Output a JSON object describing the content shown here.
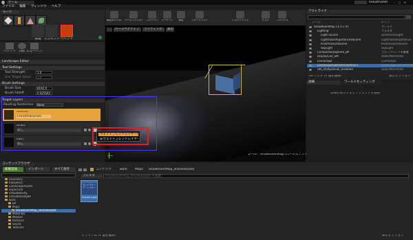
{
  "window": {
    "tab_label": "ゲーム",
    "project_name": "IndustrialVR",
    "search_placeholder": "ドキュメントの検索"
  },
  "menu": [
    "ファイル",
    "編集",
    "ウィンドウ",
    "ヘルプ"
  ],
  "mode_panel": {
    "tab_label": "モード",
    "modes_top": [
      "place-mode",
      "paint-mode",
      "landscape-mode",
      "foliage-mode"
    ],
    "modes_bottom": [
      {
        "label": "管理",
        "icon": "manage-icon"
      },
      {
        "label": "スカルプト",
        "icon": "sculpt-icon"
      },
      {
        "label": "ペイント",
        "icon": "paint-icon"
      }
    ],
    "sub_modes": [
      {
        "label": "ペイント",
        "icon": "paint-brush-icon"
      },
      {
        "label": "円形",
        "icon": "circle-brush-icon"
      },
      {
        "label": "スムージング",
        "icon": "smooth-icon"
      }
    ]
  },
  "landscape_editor": {
    "title": "Landscape Editor",
    "tool_settings": "Tool Settings",
    "tool_strength_label": "Tool Strength",
    "tool_strength_value": "1.0",
    "use_target_value_label": "Use Target Value",
    "use_target_value_value": "1.0",
    "brush_settings": "Brush Settings",
    "brush_size_label": "Brush Size",
    "brush_size_value": "8192.0",
    "brush_falloff_label": "Brush Falloff",
    "brush_falloff_value": "0.425644",
    "target_layers": "Target Layers",
    "painting_restriction_label": "Painting Restriction",
    "painting_restriction_value": "None",
    "layers": [
      {
        "name": "Ground",
        "value": "ChristmasGrass"
      },
      {
        "name": "Grass",
        "value": "なし"
      },
      {
        "name": "Path",
        "value": "なし"
      }
    ]
  },
  "context_menu": {
    "items": [
      "ウェイトブレンドレイヤー(法線)",
      "非ウェイトブレンドレイヤー"
    ]
  },
  "viewport": {
    "perspective_label": "パースペクティブ",
    "lighting_label": "ライティング",
    "show_label": "表示",
    "level_label": "レベル : ShowRoomMap (パーシステント)"
  },
  "toolbar": [
    {
      "label": "現在のレベルを保存",
      "icon": "save-icon"
    },
    {
      "label": "ソースコントロール",
      "icon": "source-control-icon"
    },
    {
      "label": "コンテンツ",
      "icon": "content-icon"
    },
    {
      "label": "マーケット",
      "icon": "market-icon"
    },
    {
      "label": "設定",
      "icon": "settings-icon"
    },
    {
      "label": "ブループリント",
      "icon": "blueprint-icon"
    },
    {
      "label": "シネマティクス",
      "icon": "cinematics-icon"
    },
    {
      "label": "ビルド",
      "icon": "build-icon"
    },
    {
      "label": "コンパイル",
      "icon": "compile-icon"
    }
  ],
  "outliner": {
    "tab_label": "アウトライナ",
    "search_placeholder": "検索",
    "col_label": "ラベル",
    "col_type": "タイプ",
    "rows": [
      {
        "label": "ShowRoomMap (エディタ)",
        "type": "ワールド"
      },
      {
        "label": "Lighting",
        "type": "フォルダ"
      },
      {
        "label": "Light Source",
        "type": "DirectionalLight"
      },
      {
        "label": "LightmassImportanceVolume",
        "type": "LightmassImportance"
      },
      {
        "label": "PostProcessVolume",
        "type": "PostProcessVolume"
      },
      {
        "label": "SkyLight",
        "type": "SkyLight"
      },
      {
        "label": "CompactSkySphere_BP",
        "type": "ブループリントを編集"
      },
      {
        "label": "DisplayCan_SM",
        "type": "StaticMeshActor"
      },
      {
        "label": "Landscape",
        "type": "Landscape"
      },
      {
        "label": "LandscapeGizmoActiveActor1",
        "type": "LandscapeGizmoActive"
      },
      {
        "label": "SM_Utility/Decal_Disabled",
        "type": "StaticMeshActor"
      }
    ],
    "status": "40 アクタ (1 個を選択)",
    "view_options": "表示オプション"
  },
  "details": {
    "tab_label": "詳細",
    "world_settings_tab": "ワールドセッティング",
    "empty_text": "詳細を表示するオブジェクトを選択"
  },
  "content_browser": {
    "tab_label": "コンテンツブラウザ",
    "add_new": "新規追加",
    "import": "インポート",
    "save_all": "すべて保存",
    "breadcrumb": [
      "コンテンツ",
      "work",
      "Maps",
      "ShowRoomMap_sharedassets"
    ],
    "filter_label": "フィルタ",
    "search_placeholder": "ShowRoomMap_sharedassets を検索",
    "folder_search_placeholder": "フォルダを検索",
    "tree": [
      "Geometry",
      "KiteDemo",
      "LandscapeAssets",
      "SuperGrid",
      "VirtualReality",
      "VirtualRealityBP",
      "work",
      "BP",
      "Maps",
      "ShowRoomMap_sharedassets",
      "Materials",
      "Meshes",
      "Particles",
      "Sound",
      "Textures"
    ],
    "asset_thumb_label": "ランドスケープ・レイヤー",
    "asset_name": "Ground_LayerInfo",
    "items_status": "1 アイテム (1 個を選択)",
    "view_options": "表示オプション"
  },
  "colors": {
    "accent_orange": "#e8a23a",
    "selection_blue": "#3a6ea8",
    "highlight_red": "#e02020",
    "annotation_blue": "#3d3dff",
    "add_new_green": "#4a7a2a"
  }
}
